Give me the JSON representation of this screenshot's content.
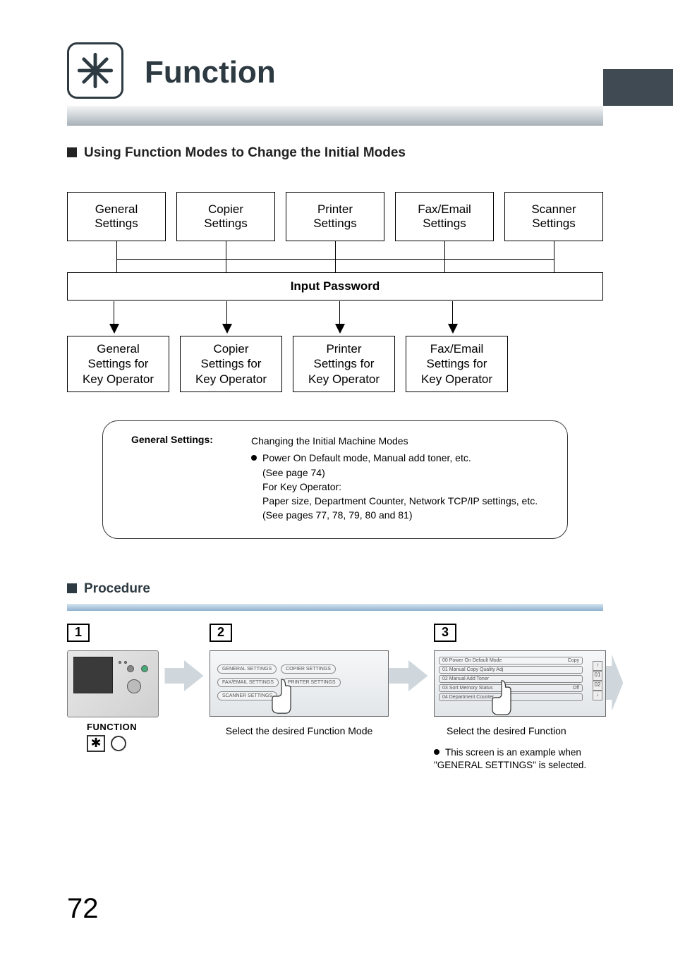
{
  "header": {
    "title": "Function"
  },
  "subtitle": "Using Function Modes to Change the Initial Modes",
  "boxes_row1": [
    "General\nSettings",
    "Copier\nSettings",
    "Printer\nSettings",
    "Fax/Email\nSettings",
    "Scanner\nSettings"
  ],
  "password_label": "Input Password",
  "boxes_row2": [
    "General\nSettings for\nKey Operator",
    "Copier\nSettings for\nKey Operator",
    "Printer\nSettings for\nKey Operator",
    "Fax/Email\nSettings for\nKey Operator"
  ],
  "note": {
    "left": "General Settings:",
    "line1": "Changing the Initial Machine Modes",
    "line2": "Power On Default mode, Manual add toner, etc.",
    "line3": "(See page 74)",
    "line4": "For Key Operator:",
    "line5": "Paper size, Department Counter, Network TCP/IP settings, etc.",
    "line6": "(See pages 77, 78, 79, 80 and 81)"
  },
  "procedure_title": "Procedure",
  "steps": {
    "s1": "1",
    "s2": "2",
    "s3": "3",
    "function_label": "FUNCTION",
    "screen2_buttons": [
      "GENERAL SETTINGS",
      "COPIER SETTINGS",
      "FAX/EMAIL SETTINGS",
      "PRINTER SETTINGS",
      "SCANNER SETTINGS"
    ],
    "caption2": "Select the desired Function Mode",
    "screen3_rows": [
      {
        "n": "00",
        "label": "Power On Default Mode",
        "val": "Copy"
      },
      {
        "n": "01",
        "label": "Manual Copy Quality Adj",
        "val": ""
      },
      {
        "n": "02",
        "label": "Manual Add Toner",
        "val": ""
      },
      {
        "n": "03",
        "label": "Sort Memory Status",
        "val": "Off"
      },
      {
        "n": "04",
        "label": "Department Counter",
        "val": ""
      }
    ],
    "scroll_labels": {
      "up": "↑",
      "mid1": "01",
      "mid2": "02",
      "down": "↓"
    },
    "caption3": "Select the desired Function",
    "note3": "This screen is an example when \"GENERAL SETTINGS\" is selected."
  },
  "page_number": "72"
}
